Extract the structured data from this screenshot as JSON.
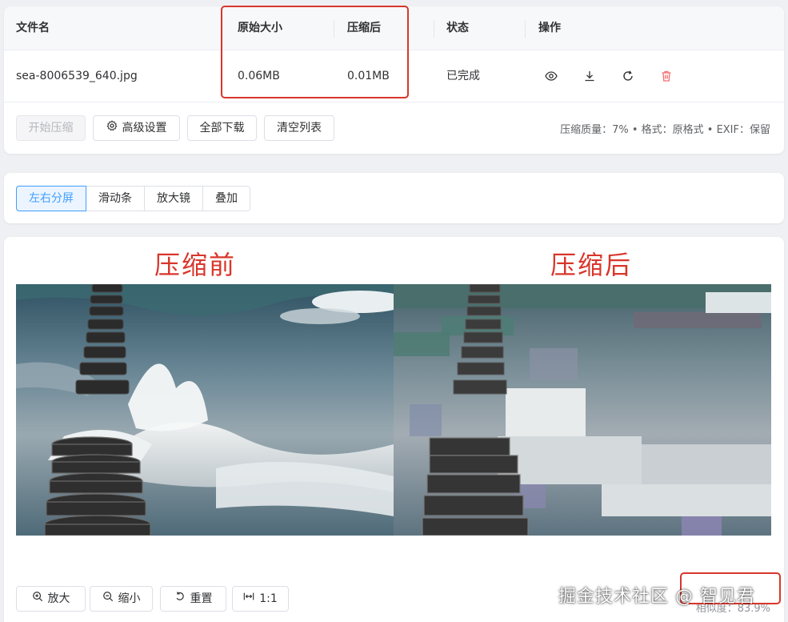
{
  "table": {
    "headers": {
      "filename": "文件名",
      "original_size": "原始大小",
      "compressed_size": "压缩后",
      "status": "状态",
      "actions": "操作"
    },
    "rows": [
      {
        "filename": "sea-8006539_640.jpg",
        "original_size": "0.06MB",
        "compressed_size": "0.01MB",
        "status": "已完成"
      }
    ],
    "action_icons": [
      "eye-icon",
      "download-icon",
      "refresh-icon",
      "trash-icon"
    ]
  },
  "toolbar": {
    "start_label": "开始压缩",
    "advanced_label": "高级设置",
    "download_all_label": "全部下载",
    "clear_label": "清空列表",
    "summary": "压缩质量：7% • 格式：原格式 • EXIF：保留"
  },
  "view_modes": {
    "items": [
      "左右分屏",
      "滑动条",
      "放大镜",
      "叠加"
    ],
    "active": "左右分屏"
  },
  "compare": {
    "before_label": "压缩前",
    "after_label": "压缩后",
    "zoom_in_label": "放大",
    "zoom_out_label": "缩小",
    "reset_label": "重置",
    "actual_size_label": "1:1",
    "similarity": "相似度：83.9%"
  },
  "watermark": "掘金技术社区 @ 智见君",
  "colors": {
    "accent": "#409eff",
    "annotation_red": "#d9362b",
    "delete_red": "#f56c6c"
  }
}
